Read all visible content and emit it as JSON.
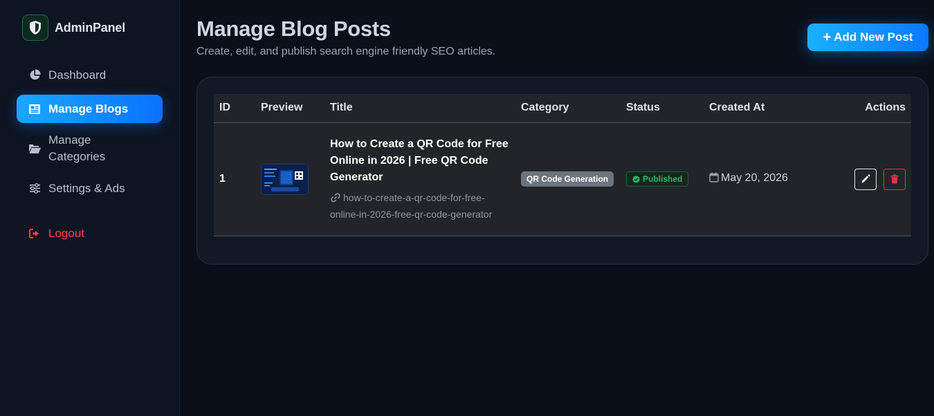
{
  "sidebar": {
    "brand": "AdminPanel",
    "items": [
      {
        "label": "Dashboard",
        "icon": "pie-chart-icon"
      },
      {
        "label": "Manage Blogs",
        "icon": "newspaper-icon",
        "active": true
      },
      {
        "label": "Manage Categories",
        "icon": "folder-open-icon"
      },
      {
        "label": "Settings & Ads",
        "icon": "sliders-icon"
      }
    ],
    "logout": "Logout"
  },
  "header": {
    "title": "Manage Blog Posts",
    "subtitle": "Create, edit, and publish search engine friendly SEO articles.",
    "add_button": "Add New Post"
  },
  "table": {
    "columns": [
      "ID",
      "Preview",
      "Title",
      "Category",
      "Status",
      "Created At",
      "Actions"
    ],
    "rows": [
      {
        "id": "1",
        "title": "How to Create a QR Code for Free Online in 2026 | Free QR Code Generator",
        "slug": "how-to-create-a-qr-code-for-free-online-in-2026-free-qr-code-generator",
        "category": "QR Code Generation",
        "status": "Published",
        "created_at": "May 20, 2026"
      }
    ]
  },
  "colors": {
    "accent": "#0a78ff",
    "background": "#0a0f1a",
    "sidebar": "#0d1422",
    "danger": "#dc3545",
    "success": "#2fb36a"
  }
}
